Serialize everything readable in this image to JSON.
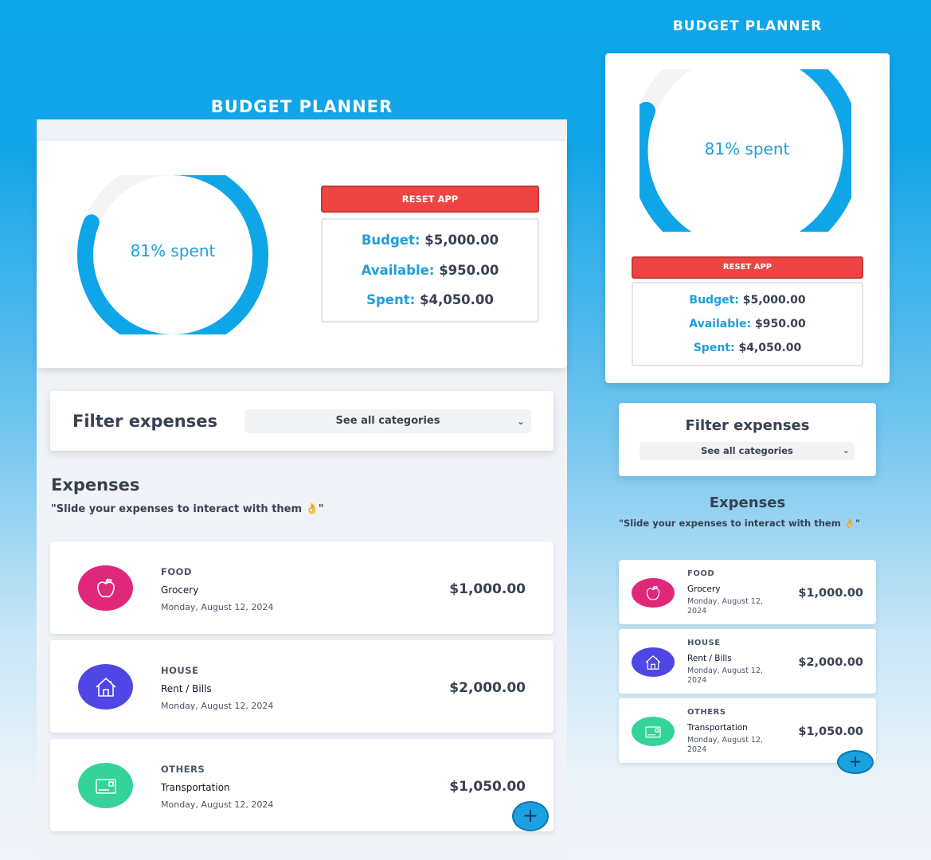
{
  "app": {
    "title": "BUDGET PLANNER",
    "percent_spent": 81,
    "ring_label": "81% spent",
    "reset_label": "RESET APP"
  },
  "totals": {
    "budget_label": "Budget:",
    "budget_value": "$5,000.00",
    "available_label": "Available:",
    "available_value": "$950.00",
    "spent_label": "Spent:",
    "spent_value": "$4,050.00"
  },
  "filter": {
    "title": "Filter expenses",
    "selected": "See all categories"
  },
  "expenses": {
    "title": "Expenses",
    "hint": "\"Slide your expenses to interact with them 👌\"",
    "items": [
      {
        "category": "FOOD",
        "name": "Grocery",
        "date": "Monday, August 12, 2024",
        "amount": "$1,000.00",
        "icon": "apple-icon",
        "color": "#e0287b"
      },
      {
        "category": "HOUSE",
        "name": "Rent / Bills",
        "date": "Monday, August 12, 2024",
        "amount": "$2,000.00",
        "icon": "house-icon",
        "color": "#4f46e5"
      },
      {
        "category": "OTHERS",
        "name": "Transportation",
        "date": "Monday, August 12, 2024",
        "amount": "$1,050.00",
        "icon": "card-icon",
        "color": "#34d399"
      }
    ]
  },
  "colors": {
    "accent": "#0ea5e9",
    "reset": "#ef4444",
    "ring_track": "#f3f4f6"
  }
}
